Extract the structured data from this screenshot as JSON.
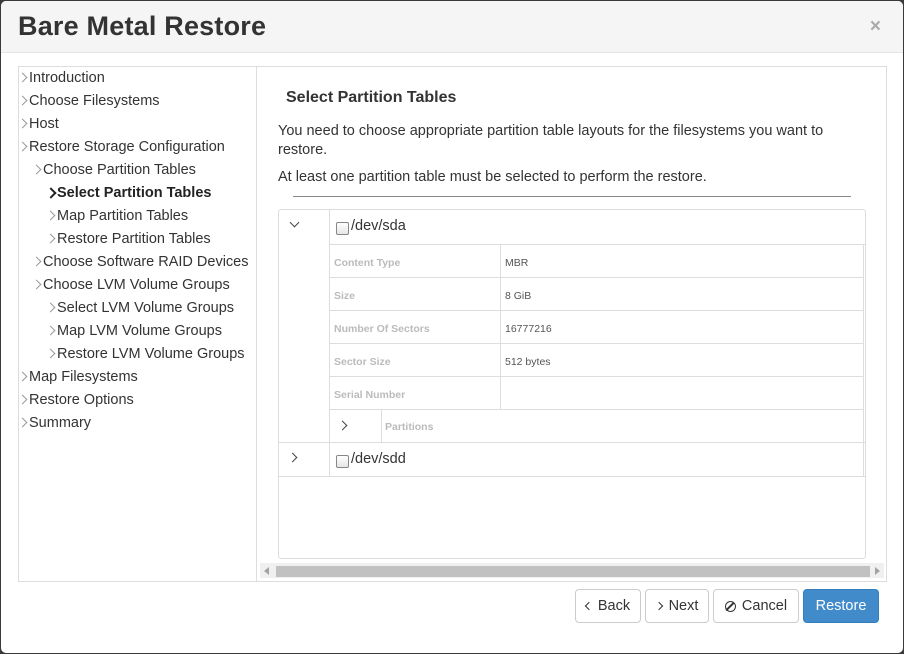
{
  "dialog": {
    "title": "Bare Metal Restore",
    "close": "×"
  },
  "nav": {
    "items": [
      {
        "label": "Introduction",
        "level": 0
      },
      {
        "label": "Choose Filesystems",
        "level": 0
      },
      {
        "label": "Host",
        "level": 0
      },
      {
        "label": "Restore Storage Configuration",
        "level": 0
      },
      {
        "label": "Choose Partition Tables",
        "level": 1
      },
      {
        "label": "Select Partition Tables",
        "level": 2,
        "active": true
      },
      {
        "label": "Map Partition Tables",
        "level": 2
      },
      {
        "label": "Restore Partition Tables",
        "level": 2
      },
      {
        "label": "Choose Software RAID Devices",
        "level": 1
      },
      {
        "label": "Choose LVM Volume Groups",
        "level": 1
      },
      {
        "label": "Select LVM Volume Groups",
        "level": 2
      },
      {
        "label": "Map LVM Volume Groups",
        "level": 2
      },
      {
        "label": "Restore LVM Volume Groups",
        "level": 2
      },
      {
        "label": "Map Filesystems",
        "level": 0
      },
      {
        "label": "Restore Options",
        "level": 0
      },
      {
        "label": "Summary",
        "level": 0
      }
    ]
  },
  "content": {
    "title": "Select Partition Tables",
    "intro": "You need to choose appropriate partition table layouts for the filesystems you want to restore.",
    "note": "At least one partition table must be selected to perform the restore."
  },
  "devices": [
    {
      "name": "/dev/sda",
      "expanded": true,
      "properties": [
        {
          "name": "Content Type",
          "value": "MBR"
        },
        {
          "name": "Size",
          "value": "8 GiB"
        },
        {
          "name": "Number Of Sectors",
          "value": "16777216"
        },
        {
          "name": "Sector Size",
          "value": "512 bytes"
        },
        {
          "name": "Serial Number",
          "value": ""
        }
      ],
      "partitions_label": "Partitions"
    },
    {
      "name": "/dev/sdd",
      "expanded": false
    }
  ],
  "buttons": {
    "back": "Back",
    "next": "Next",
    "cancel": "Cancel",
    "restore": "Restore"
  },
  "colors": {
    "primary": "#428bca"
  }
}
